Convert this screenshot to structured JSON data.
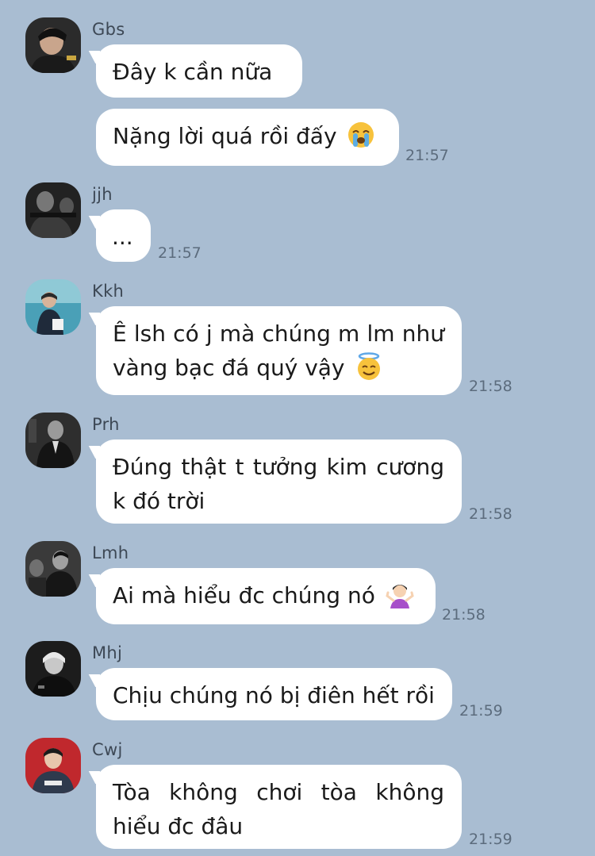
{
  "messages": [
    {
      "sender": "Gbs",
      "bubbles": [
        "Đây k cần nữa",
        "Nặng lời quá rồi đấy"
      ],
      "emoji": "loudly-crying-face",
      "time": "21:57"
    },
    {
      "sender": "jjh",
      "bubbles": [
        "..."
      ],
      "time": "21:57"
    },
    {
      "sender": "Kkh",
      "bubbles": [
        "Ê lsh có j mà chúng m lm như vàng bạc đá quý vậy"
      ],
      "emoji": "smiling-face-with-halo",
      "time": "21:58"
    },
    {
      "sender": "Prh",
      "bubbles": [
        "Đúng thật t tưởng kim cương k đó trời"
      ],
      "time": "21:58"
    },
    {
      "sender": "Lmh",
      "bubbles": [
        "Ai mà hiểu đc chúng nó"
      ],
      "emoji": "person-shrugging",
      "time": "21:58"
    },
    {
      "sender": "Mhj",
      "bubbles": [
        "Chịu chúng nó bị điên hết rồi"
      ],
      "time": "21:59"
    },
    {
      "sender": "Cwj",
      "bubbles": [
        "Tòa không chơi tòa không hiểu đc đâu"
      ],
      "time": "21:59"
    }
  ],
  "colors": {
    "background": "#a9bdd2",
    "bubble": "#ffffff",
    "sender_text": "#3d4855",
    "time_text": "#5c6c7d"
  }
}
